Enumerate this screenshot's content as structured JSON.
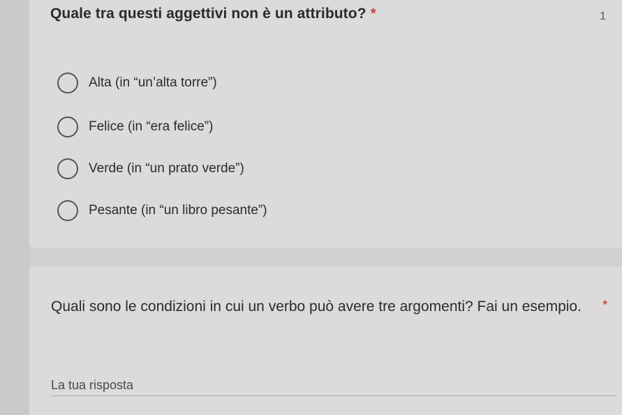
{
  "question1": {
    "title": "Quale tra questi aggettivi non è un attributo?",
    "required_marker": "*",
    "corner_number": "1",
    "options": [
      {
        "label": "Alta (in “un’alta torre”)"
      },
      {
        "label": "Felice (in “era felice”)"
      },
      {
        "label": "Verde (in “un prato verde”)"
      },
      {
        "label": "Pesante (in “un libro pesante”)"
      }
    ]
  },
  "question2": {
    "title": "Quali sono le condizioni in cui un verbo può avere tre argomenti? Fai un esempio.",
    "required_marker": "*",
    "answer_placeholder": "La tua risposta",
    "answer_value": ""
  }
}
